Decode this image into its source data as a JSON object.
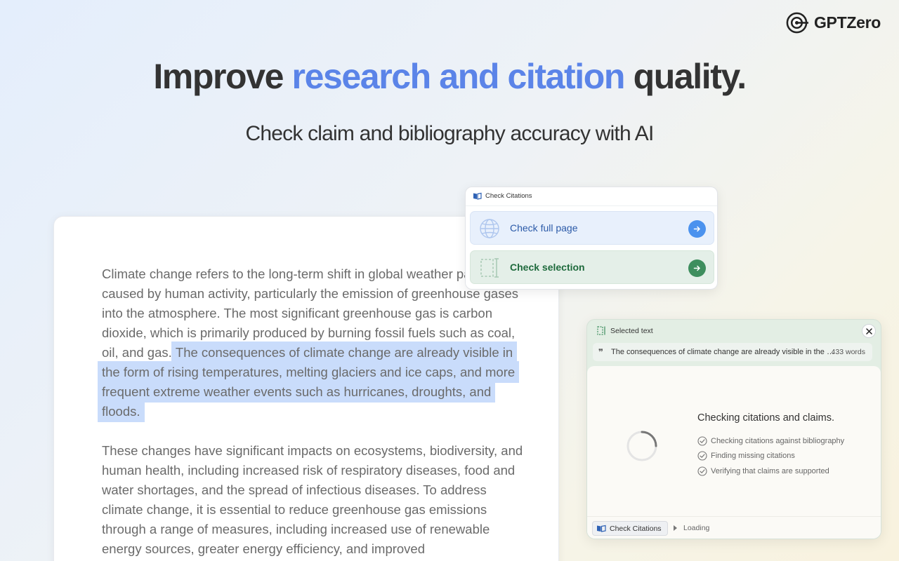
{
  "logo": {
    "text": "GPTZero"
  },
  "hero": {
    "headline_before": "Improve ",
    "headline_accent": "research and citation",
    "headline_after": " quality.",
    "subhead": "Check claim and bibliography accuracy with AI",
    "accent_color": "#5b84e8"
  },
  "document": {
    "paragraph1_plain": "Climate change refers to the long-term shift in global weather patterns caused by human activity, particularly the emission of greenhouse gases into the atmosphere. The most significant greenhouse gas is carbon dioxide, which is primarily produced by burning fossil fuels such as coal, oil, and gas. ",
    "paragraph1_highlighted": "The consequences of climate change are already visible in the form of rising temperatures, melting glaciers and ice caps, and more frequent extreme weather events such as hurricanes, droughts, and floods. ",
    "paragraph2": "These changes have significant impacts on ecosystems, biodiversity, and human health, including increased risk of respiratory diseases, food and water shortages, and the spread of infectious diseases. To address climate change, it is essential to reduce greenhouse gas emissions through a range of measures, including increased use of renewable energy sources, greater energy efficiency, and improved"
  },
  "popup": {
    "title": "Check Citations",
    "options": [
      {
        "label": "Check full page",
        "icon": "globe-icon",
        "color": "#4b92ee"
      },
      {
        "label": "Check selection",
        "icon": "selection-icon",
        "color": "#3e8e5e"
      }
    ]
  },
  "panel": {
    "title": "Selected text",
    "quote_text": "The consequences of climate change are already visible in the form of rising temperatures, melting glaciers and ice caps",
    "word_count": "433 words",
    "status_title": "Checking citations and claims.",
    "checks": [
      "Checking citations against bibliography",
      "Finding missing citations",
      "Verifying that claims are supported"
    ],
    "footer_button": "Check Citations",
    "footer_status": "Loading"
  }
}
